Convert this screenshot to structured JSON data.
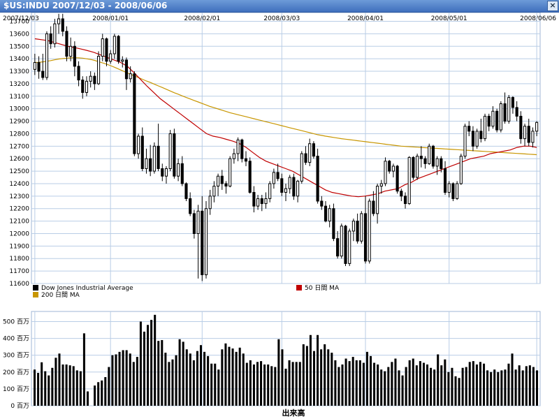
{
  "window": {
    "title": "$US:INDU 2007/12/03 - 2008/06/06",
    "close_symbol": "×"
  },
  "legend": {
    "items": [
      {
        "label": "Dow Jones Industrial Average",
        "color": "#000000"
      },
      {
        "label": "50 日間 MA",
        "color": "#c00000"
      },
      {
        "label": "200 日間 MA",
        "color": "#c89600"
      }
    ]
  },
  "volume_axis_title": "出来高",
  "colors": {
    "grid": "#b9cde6",
    "border": "#9fb6d4",
    "candle": "#000000",
    "ma50": "#c00000",
    "ma200": "#c89600",
    "volume": "#000000"
  },
  "chart_data": [
    {
      "type": "candlestick",
      "series_name": "Dow Jones Industrial Average",
      "x_tick_labels": [
        "2007/12/03",
        "2008/01/01",
        "2008/02/01",
        "2008/03/03",
        "2008/04/01",
        "2008/05/01",
        "2008/06/06"
      ],
      "x_tick_index": [
        0,
        19,
        42,
        62,
        83,
        104,
        126
      ],
      "y_ticks": [
        11600,
        11700,
        11800,
        11900,
        12000,
        12100,
        12200,
        12300,
        12400,
        12500,
        12600,
        12700,
        12800,
        12900,
        13000,
        13100,
        13200,
        13300,
        13400,
        13500,
        13600,
        13700
      ],
      "ylim": [
        11600,
        13770
      ],
      "ohlc": [
        [
          13315,
          13440,
          13270,
          13370
        ],
        [
          13370,
          13420,
          13240,
          13300
        ],
        [
          13300,
          13440,
          13230,
          13250
        ],
        [
          13250,
          13620,
          13230,
          13600
        ],
        [
          13600,
          13660,
          13480,
          13520
        ],
        [
          13520,
          13720,
          13490,
          13680
        ],
        [
          13680,
          13760,
          13600,
          13720
        ],
        [
          13720,
          13760,
          13580,
          13620
        ],
        [
          13620,
          13660,
          13380,
          13420
        ],
        [
          13420,
          13570,
          13380,
          13500
        ],
        [
          13500,
          13540,
          13260,
          13340
        ],
        [
          13340,
          13380,
          13180,
          13230
        ],
        [
          13230,
          13260,
          13080,
          13130
        ],
        [
          13130,
          13260,
          13100,
          13220
        ],
        [
          13220,
          13300,
          13170,
          13260
        ],
        [
          13260,
          13290,
          13150,
          13200
        ],
        [
          13200,
          13460,
          13190,
          13420
        ],
        [
          13420,
          13600,
          13380,
          13560
        ],
        [
          13560,
          13570,
          13340,
          13380
        ],
        [
          13380,
          13470,
          13360,
          13440
        ],
        [
          13440,
          13600,
          13400,
          13580
        ],
        [
          13580,
          13590,
          13360,
          13380
        ],
        [
          13380,
          13420,
          13330,
          13390
        ],
        [
          13390,
          13410,
          13150,
          13240
        ],
        [
          13240,
          13340,
          13210,
          13280
        ],
        [
          13280,
          13300,
          12620,
          12640
        ],
        [
          12640,
          12800,
          12600,
          12780
        ],
        [
          12780,
          12850,
          12500,
          12520
        ],
        [
          12520,
          12680,
          12480,
          12600
        ],
        [
          12600,
          12710,
          12460,
          12500
        ],
        [
          12500,
          12730,
          12480,
          12700
        ],
        [
          12700,
          12880,
          12500,
          12520
        ],
        [
          12520,
          12560,
          12420,
          12460
        ],
        [
          12460,
          12540,
          12400,
          12520
        ],
        [
          12520,
          12830,
          12500,
          12800
        ],
        [
          12800,
          12840,
          12440,
          12460
        ],
        [
          12460,
          12600,
          12420,
          12560
        ],
        [
          12560,
          12620,
          12380,
          12400
        ],
        [
          12400,
          12410,
          12260,
          12280
        ],
        [
          12280,
          12330,
          12140,
          12160
        ],
        [
          12160,
          12190,
          11960,
          12000
        ],
        [
          12000,
          12230,
          11640,
          12180
        ],
        [
          12180,
          12300,
          11620,
          11670
        ],
        [
          11670,
          12260,
          11640,
          12200
        ],
        [
          12200,
          12350,
          12150,
          12300
        ],
        [
          12300,
          12420,
          12250,
          12380
        ],
        [
          12380,
          12480,
          12300,
          12460
        ],
        [
          12460,
          12510,
          12350,
          12400
        ],
        [
          12400,
          12420,
          12320,
          12380
        ],
        [
          12380,
          12620,
          12370,
          12600
        ],
        [
          12600,
          12680,
          12560,
          12640
        ],
        [
          12640,
          12770,
          12580,
          12750
        ],
        [
          12750,
          12760,
          12570,
          12600
        ],
        [
          12600,
          12660,
          12540,
          12580
        ],
        [
          12580,
          12610,
          12320,
          12330
        ],
        [
          12330,
          12380,
          12170,
          12220
        ],
        [
          12220,
          12310,
          12190,
          12280
        ],
        [
          12280,
          12310,
          12180,
          12240
        ],
        [
          12240,
          12330,
          12200,
          12280
        ],
        [
          12280,
          12420,
          12250,
          12400
        ],
        [
          12400,
          12520,
          12360,
          12490
        ],
        [
          12490,
          12560,
          12420,
          12440
        ],
        [
          12440,
          12480,
          12300,
          12330
        ],
        [
          12330,
          12400,
          12260,
          12360
        ],
        [
          12360,
          12470,
          12320,
          12450
        ],
        [
          12450,
          12480,
          12270,
          12300
        ],
        [
          12300,
          12430,
          12250,
          12420
        ],
        [
          12420,
          12660,
          12400,
          12640
        ],
        [
          12640,
          12700,
          12550,
          12570
        ],
        [
          12570,
          12760,
          12540,
          12720
        ],
        [
          12720,
          12740,
          12600,
          12620
        ],
        [
          12620,
          12680,
          12240,
          12260
        ],
        [
          12260,
          12300,
          12190,
          12220
        ],
        [
          12220,
          12260,
          12090,
          12100
        ],
        [
          12100,
          12230,
          12050,
          12200
        ],
        [
          12200,
          12240,
          11940,
          11960
        ],
        [
          11960,
          12020,
          11800,
          11820
        ],
        [
          11820,
          12080,
          11800,
          12060
        ],
        [
          12060,
          12070,
          11740,
          11760
        ],
        [
          11760,
          12040,
          11740,
          12020
        ],
        [
          12020,
          12120,
          11940,
          12100
        ],
        [
          12100,
          12160,
          11920,
          11940
        ],
        [
          11940,
          12180,
          11920,
          12160
        ],
        [
          12160,
          12300,
          11760,
          11780
        ],
        [
          11780,
          12280,
          11760,
          12260
        ],
        [
          12260,
          12340,
          12140,
          12160
        ],
        [
          12160,
          12400,
          12080,
          12380
        ],
        [
          12380,
          12430,
          12320,
          12400
        ],
        [
          12400,
          12610,
          12380,
          12580
        ],
        [
          12580,
          12590,
          12480,
          12500
        ],
        [
          12500,
          12560,
          12450,
          12540
        ],
        [
          12540,
          12550,
          12320,
          12340
        ],
        [
          12340,
          12360,
          12260,
          12300
        ],
        [
          12300,
          12330,
          12200,
          12240
        ],
        [
          12240,
          12620,
          12230,
          12610
        ],
        [
          12610,
          12620,
          12430,
          12450
        ],
        [
          12450,
          12640,
          12430,
          12620
        ],
        [
          12620,
          12700,
          12530,
          12600
        ],
        [
          12600,
          12620,
          12520,
          12560
        ],
        [
          12560,
          12720,
          12550,
          12700
        ],
        [
          12700,
          12710,
          12520,
          12540
        ],
        [
          12540,
          12620,
          12470,
          12600
        ],
        [
          12600,
          12620,
          12490,
          12520
        ],
        [
          12520,
          12580,
          12310,
          12330
        ],
        [
          12330,
          12420,
          12290,
          12400
        ],
        [
          12400,
          12410,
          12260,
          12280
        ],
        [
          12280,
          12420,
          12270,
          12400
        ],
        [
          12400,
          12640,
          12390,
          12620
        ],
        [
          12620,
          12880,
          12600,
          12860
        ],
        [
          12860,
          12900,
          12780,
          12820
        ],
        [
          12820,
          12860,
          12660,
          12700
        ],
        [
          12700,
          12840,
          12680,
          12820
        ],
        [
          12820,
          12920,
          12730,
          12760
        ],
        [
          12760,
          12960,
          12740,
          12940
        ],
        [
          12940,
          12960,
          12820,
          12860
        ],
        [
          12860,
          13020,
          12840,
          12980
        ],
        [
          12980,
          13000,
          12810,
          12830
        ],
        [
          12830,
          13060,
          12810,
          13040
        ],
        [
          13040,
          13130,
          12880,
          12900
        ],
        [
          12900,
          13110,
          12880,
          13090
        ],
        [
          13090,
          13100,
          12960,
          13010
        ],
        [
          13010,
          13060,
          12900,
          12940
        ],
        [
          12940,
          12980,
          12720,
          12760
        ],
        [
          12760,
          12880,
          12700,
          12860
        ],
        [
          12860,
          12920,
          12700,
          12730
        ],
        [
          12730,
          12850,
          12690,
          12820
        ],
        [
          12820,
          12900,
          12780,
          12890
        ]
      ],
      "ma50": [
        13560,
        13553,
        13545,
        13530,
        13515,
        13500,
        13490,
        13478,
        13465,
        13450,
        13430,
        13410,
        13390,
        13370,
        13340,
        13290,
        13235,
        13180,
        13130,
        13080,
        13040,
        13000,
        12960,
        12920,
        12880,
        12840,
        12800,
        12780,
        12770,
        12755,
        12740,
        12720,
        12690,
        12650,
        12610,
        12580,
        12560,
        12540,
        12520,
        12500,
        12470,
        12440,
        12410,
        12380,
        12350,
        12330,
        12320,
        12310,
        12300,
        12295,
        12300,
        12310,
        12320,
        12340,
        12350,
        12360,
        12390,
        12410,
        12440,
        12460,
        12480,
        12500,
        12520,
        12540,
        12560,
        12580,
        12600,
        12610,
        12620,
        12640,
        12650,
        12660,
        12670,
        12690,
        12700,
        12700,
        12690
      ],
      "ma200": [
        13370,
        13372,
        13375,
        13380,
        13385,
        13392,
        13398,
        13402,
        13405,
        13407,
        13408,
        13407,
        13405,
        13400,
        13395,
        13387,
        13377,
        13367,
        13357,
        13345,
        13332,
        13318,
        13304,
        13290,
        13276,
        13262,
        13250,
        13236,
        13222,
        13210,
        13196,
        13183,
        13170,
        13156,
        13142,
        13128,
        13116,
        13103,
        13090,
        13078,
        13066,
        13054,
        13042,
        13030,
        13018,
        13008,
        12998,
        12988,
        12978,
        12968,
        12960,
        12952,
        12944,
        12936,
        12928,
        12920,
        12912,
        12904,
        12896,
        12888,
        12880,
        12872,
        12864,
        12856,
        12848,
        12840,
        12832,
        12824,
        12816,
        12808,
        12800,
        12792,
        12786,
        12780,
        12775,
        12770,
        12765,
        12760,
        12756,
        12752,
        12748,
        12744,
        12740,
        12736,
        12732,
        12728,
        12724,
        12720,
        12716,
        12712,
        12708,
        12704,
        12700,
        12698,
        12696,
        12694,
        12692,
        12690,
        12688,
        12686,
        12684,
        12682,
        12680,
        12678,
        12676,
        12674,
        12672,
        12670,
        12668,
        12666,
        12664,
        12662,
        12660,
        12658,
        12656,
        12654,
        12652,
        12650,
        12648,
        12646,
        12644,
        12642,
        12640,
        12638,
        12636,
        12634,
        12632
      ]
    },
    {
      "type": "bar",
      "series_name": "出来高",
      "y_ticks": [
        0,
        100,
        200,
        300,
        400,
        500
      ],
      "y_tick_labels": [
        "0 百万",
        "100 百万",
        "200 百万",
        "300 百万",
        "400 百万",
        "500 百万"
      ],
      "ylim": [
        0,
        560
      ],
      "values": [
        215,
        195,
        258,
        205,
        180,
        225,
        285,
        310,
        245,
        245,
        240,
        235,
        210,
        205,
        430,
        85,
        0,
        120,
        140,
        150,
        170,
        230,
        300,
        305,
        320,
        330,
        330,
        310,
        260,
        290,
        500,
        440,
        480,
        510,
        540,
        385,
        390,
        315,
        260,
        275,
        300,
        395,
        380,
        335,
        310,
        270,
        325,
        360,
        320,
        295,
        250,
        250,
        215,
        335,
        370,
        350,
        340,
        320,
        345,
        310,
        255,
        270,
        245,
        260,
        265,
        245,
        245,
        235,
        230,
        395,
        335,
        220,
        270,
        260,
        260,
        260,
        365,
        355,
        420,
        325,
        420,
        335,
        365,
        335,
        315,
        270,
        230,
        245,
        280,
        265,
        290,
        270,
        270,
        255,
        320,
        295,
        255,
        245,
        215,
        205,
        230,
        260,
        280,
        210,
        180,
        230,
        270,
        280,
        240,
        265,
        255,
        245,
        225,
        215,
        305,
        240,
        275,
        200,
        225,
        175,
        165,
        225,
        230,
        260,
        265,
        245,
        260,
        250,
        210,
        200,
        215,
        200,
        210,
        215,
        250,
        310,
        215,
        240,
        210,
        235,
        240,
        230,
        210
      ]
    }
  ]
}
